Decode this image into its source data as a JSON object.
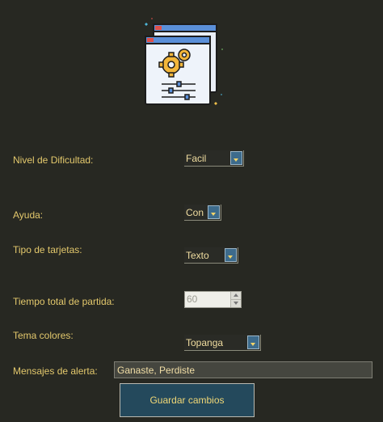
{
  "header": {
    "icon": "settings-gears-window-icon"
  },
  "form": {
    "difficulty_label": "Nivel de Dificultad:",
    "difficulty_value": "Facil",
    "help_label": "Ayuda:",
    "help_value": "Con",
    "cards_label": "Tipo de tarjetas:",
    "cards_value": "Texto",
    "time_label": "Tiempo total de partida:",
    "time_value": "60",
    "theme_label": "Tema colores:",
    "theme_value": "Topanga",
    "messages_label": "Mensajes de alerta:",
    "messages_value": "Ganaste, Perdiste",
    "save_label": "Guardar cambios"
  },
  "colors": {
    "background": "#272822",
    "label_text": "#e3c86c",
    "button_background": "#24495c",
    "dropdown_button": "#3d6b8c"
  }
}
